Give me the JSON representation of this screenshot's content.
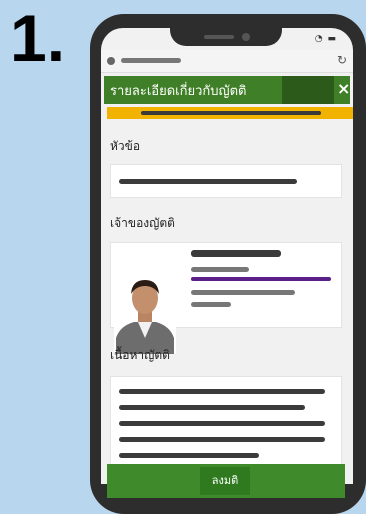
{
  "step": {
    "number": "1."
  },
  "browser": {
    "reload_icon": "reload-icon",
    "status_icons": "wifi-icon battery-icon"
  },
  "header": {
    "title": "รายละเอียดเกี่ยวกับญัตติ",
    "close_label": "×"
  },
  "sections": {
    "topic_label": "หัวข้อ",
    "owner_label": "เจ้าของญัตติ",
    "content_label": "เนื้อหาญัตติ"
  },
  "footer": {
    "vote_button_label": "ลงมติ"
  },
  "colors": {
    "header_green": "#3f7f27",
    "accent_yellow": "#f2b300",
    "owner_purple": "#5b1f8a",
    "page_background": "#b9d6ef"
  }
}
